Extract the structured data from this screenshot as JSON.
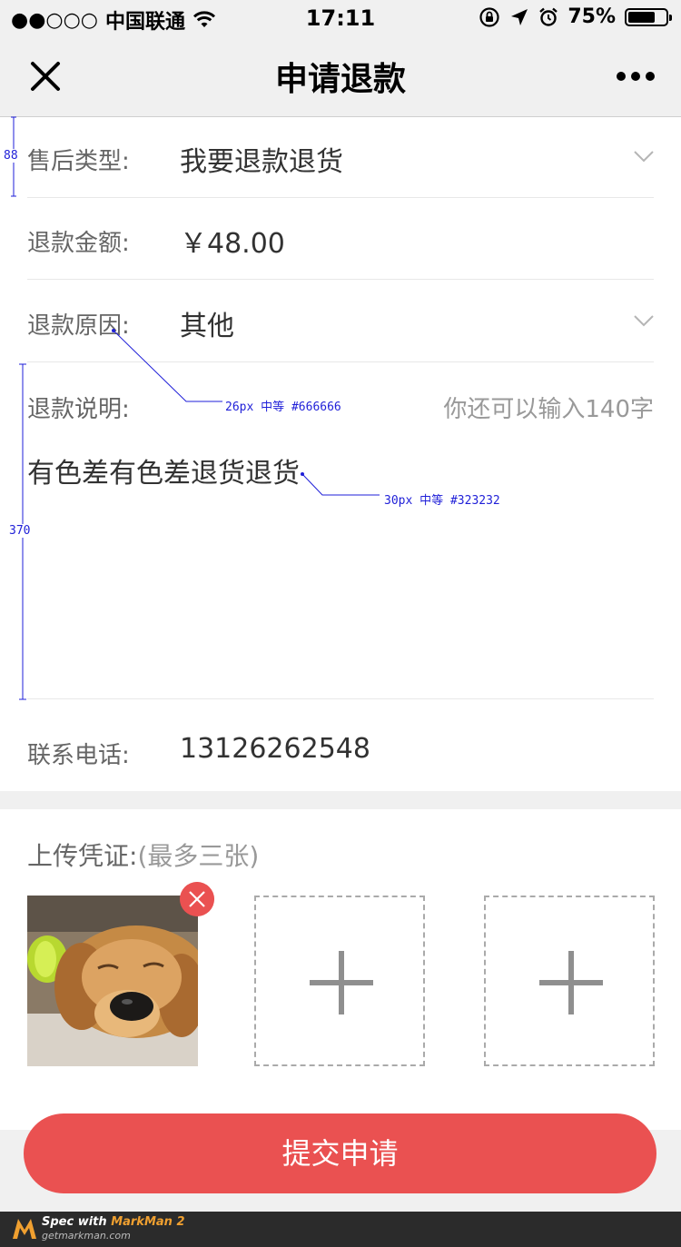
{
  "status_bar": {
    "signal": "●●○○○",
    "carrier": "中国联通",
    "time": "17:11",
    "battery": "75%",
    "battery_level": 0.75
  },
  "nav": {
    "title": "申请退款"
  },
  "form": {
    "after_sale_type": {
      "label": "售后类型:",
      "value": "我要退款退货"
    },
    "refund_amount": {
      "label": "退款金额:",
      "value": "￥48.00"
    },
    "refund_reason": {
      "label": "退款原因:",
      "value": "其他"
    },
    "refund_description": {
      "label": "退款说明:",
      "counter": "你还可以输入140字",
      "value": "有色差有色差退货退货"
    },
    "phone": {
      "label": "联系电话:",
      "value": "13126262548"
    }
  },
  "upload": {
    "title": "上传凭证:",
    "hint": "(最多三张)"
  },
  "submit_label": "提交申请",
  "annotations": {
    "height_row": "88",
    "height_desc": "370",
    "label_spec": "26px 中等 #666666",
    "text_spec": "30px 中等 #323232",
    "annotation_color": "#1f1fd8"
  },
  "footer": {
    "line1_prefix": "Spec with ",
    "line1_brand": "MarkMan 2",
    "line2": "getmarkman.com"
  },
  "colors": {
    "accent": "#ea5151",
    "label": "#666666",
    "text": "#323232",
    "hint": "#999999"
  }
}
